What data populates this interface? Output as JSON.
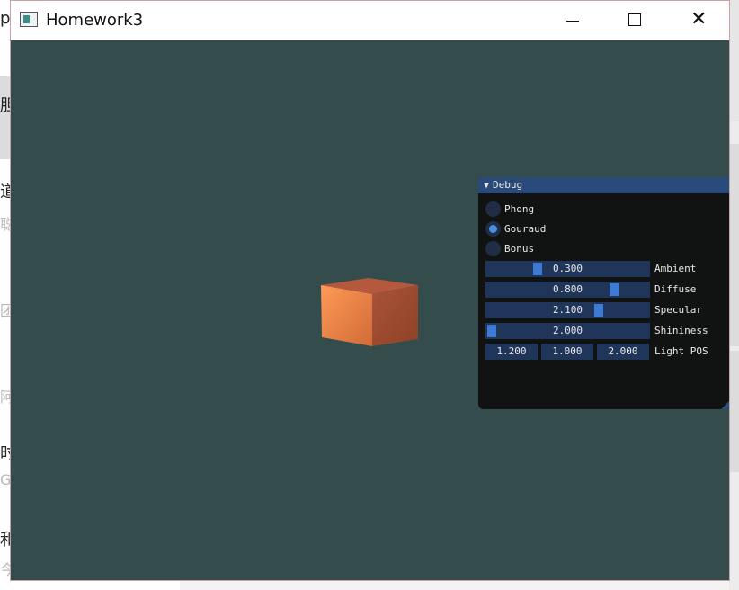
{
  "window": {
    "title": "Homework3",
    "icon": "app-window-icon"
  },
  "background": {
    "glyphs": [
      "p",
      "胆",
      "道",
      "聪",
      "团",
      "阿",
      "时",
      "G",
      "和",
      "今"
    ]
  },
  "debug": {
    "title": "Debug",
    "modes": [
      {
        "label": "Phong",
        "checked": false
      },
      {
        "label": "Gouraud",
        "checked": true
      },
      {
        "label": "Bonus",
        "checked": false
      }
    ],
    "sliders": [
      {
        "label": "Ambient",
        "value": "0.300"
      },
      {
        "label": "Diffuse",
        "value": "0.800"
      },
      {
        "label": "Specular",
        "value": "2.100"
      },
      {
        "label": "Shininess",
        "value": "2.000"
      }
    ],
    "light_pos": {
      "label": "Light POS",
      "values": [
        "1.200",
        "1.000",
        "2.000"
      ]
    }
  },
  "colors": {
    "viewport_bg": "#344c4c",
    "panel_bg": "#111313",
    "panel_header": "#294a7a",
    "accent": "#3d7ad6",
    "cube_front": "#f08a4b",
    "cube_side": "#9c4a2e"
  }
}
